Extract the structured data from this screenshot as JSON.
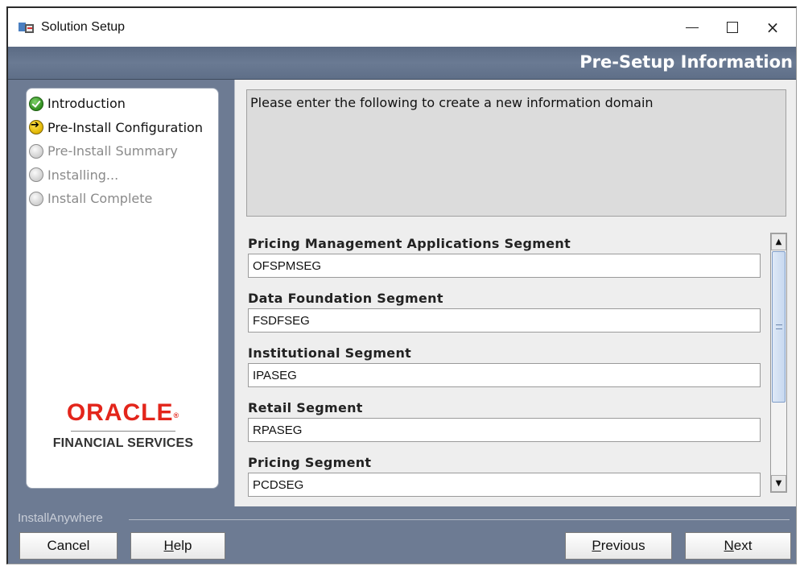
{
  "window": {
    "title": "Solution Setup",
    "controls": {
      "minimize": "minimize",
      "maximize": "maximize",
      "close": "×"
    }
  },
  "header": {
    "title": "Pre-Setup Information"
  },
  "sidebar": {
    "steps": [
      {
        "label": "Introduction",
        "state": "done"
      },
      {
        "label": "Pre-Install Configuration",
        "state": "current"
      },
      {
        "label": "Pre-Install Summary",
        "state": "pending"
      },
      {
        "label": "Installing...",
        "state": "pending"
      },
      {
        "label": "Install Complete",
        "state": "pending"
      }
    ],
    "logo": {
      "brand": "ORACLE",
      "subtitle": "FINANCIAL SERVICES"
    }
  },
  "main": {
    "instruction": "Please enter the following to create a new information domain",
    "fields": [
      {
        "label": "Pricing Management Applications Segment",
        "value": "OFSPMSEG"
      },
      {
        "label": "Data Foundation Segment",
        "value": "FSDFSEG"
      },
      {
        "label": "Institutional Segment",
        "value": "IPASEG"
      },
      {
        "label": "Retail Segment",
        "value": "RPASEG"
      },
      {
        "label": "Pricing Segment",
        "value": "PCDSEG"
      }
    ]
  },
  "footer": {
    "installer_label": "InstallAnywhere",
    "buttons": {
      "cancel": "Cancel",
      "help_mnemonic": "H",
      "help_rest": "elp",
      "previous_mnemonic": "P",
      "previous_rest": "revious",
      "next_mnemonic": "N",
      "next_rest": "ext"
    }
  },
  "colors": {
    "header_bar": "#5f6f88",
    "body_background": "#6d7b93",
    "oracle_red": "#e3251b",
    "step_done": "#2f8d1e",
    "step_current": "#e0b400"
  }
}
